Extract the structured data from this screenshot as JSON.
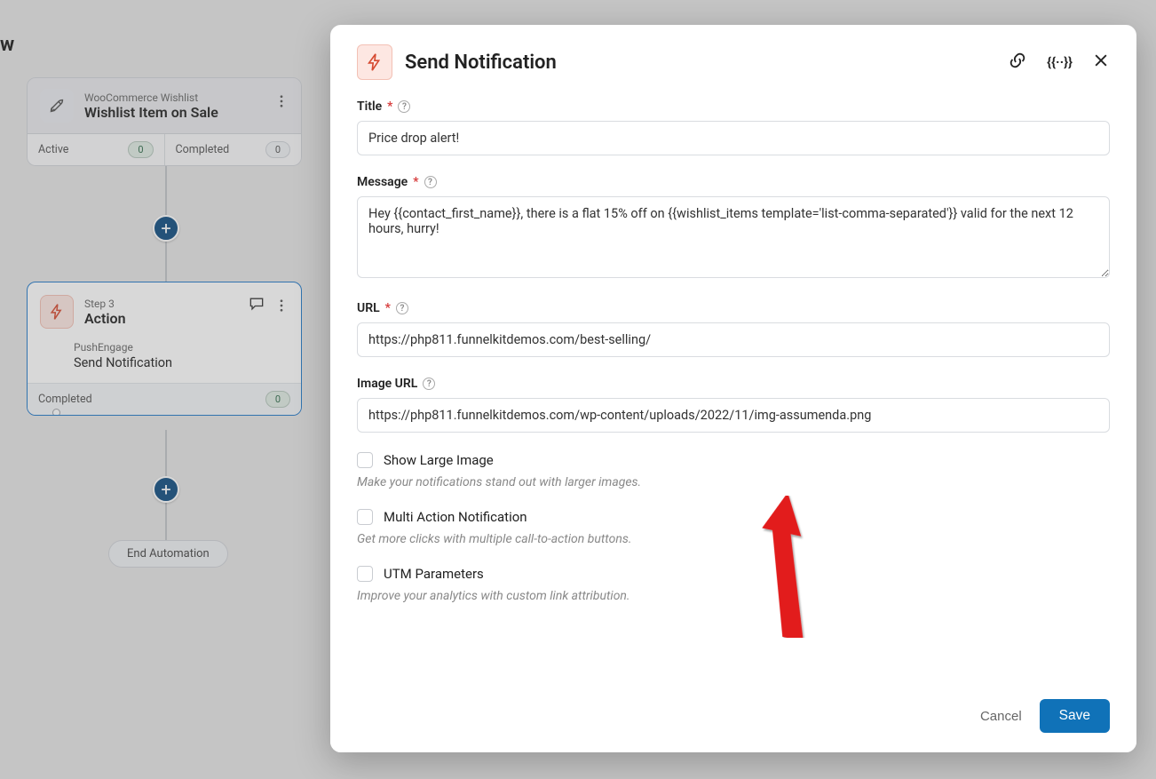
{
  "page": {
    "title_fragment": "w"
  },
  "flow": {
    "trigger": {
      "subtitle": "WooCommerce Wishlist",
      "title": "Wishlist Item on Sale",
      "active_label": "Active",
      "active_count": 0,
      "completed_label": "Completed",
      "completed_count": 0
    },
    "action": {
      "step_label": "Step 3",
      "type_label": "Action",
      "provider": "PushEngage",
      "action_name": "Send Notification",
      "completed_label": "Completed",
      "completed_count": 0
    },
    "end_label": "End Automation"
  },
  "modal": {
    "title": "Send Notification",
    "fields": {
      "title": {
        "label": "Title",
        "value": "Price drop alert!"
      },
      "message": {
        "label": "Message",
        "value": "Hey {{contact_first_name}}, there is a flat 15% off on {{wishlist_items template='list-comma-separated'}} valid for the next 12 hours, hurry!"
      },
      "url": {
        "label": "URL",
        "value": "https://php811.funnelkitdemos.com/best-selling/"
      },
      "image_url": {
        "label": "Image URL",
        "value": "https://php811.funnelkitdemos.com/wp-content/uploads/2022/11/img-assumenda.png"
      }
    },
    "options": {
      "large_image": {
        "label": "Show Large Image",
        "desc": "Make your notifications stand out with larger images."
      },
      "multi_action": {
        "label": "Multi Action Notification",
        "desc": "Get more clicks with multiple call-to-action buttons."
      },
      "utm": {
        "label": "UTM Parameters",
        "desc": "Improve your analytics with custom link attribution."
      }
    },
    "footer": {
      "cancel": "Cancel",
      "save": "Save"
    }
  }
}
